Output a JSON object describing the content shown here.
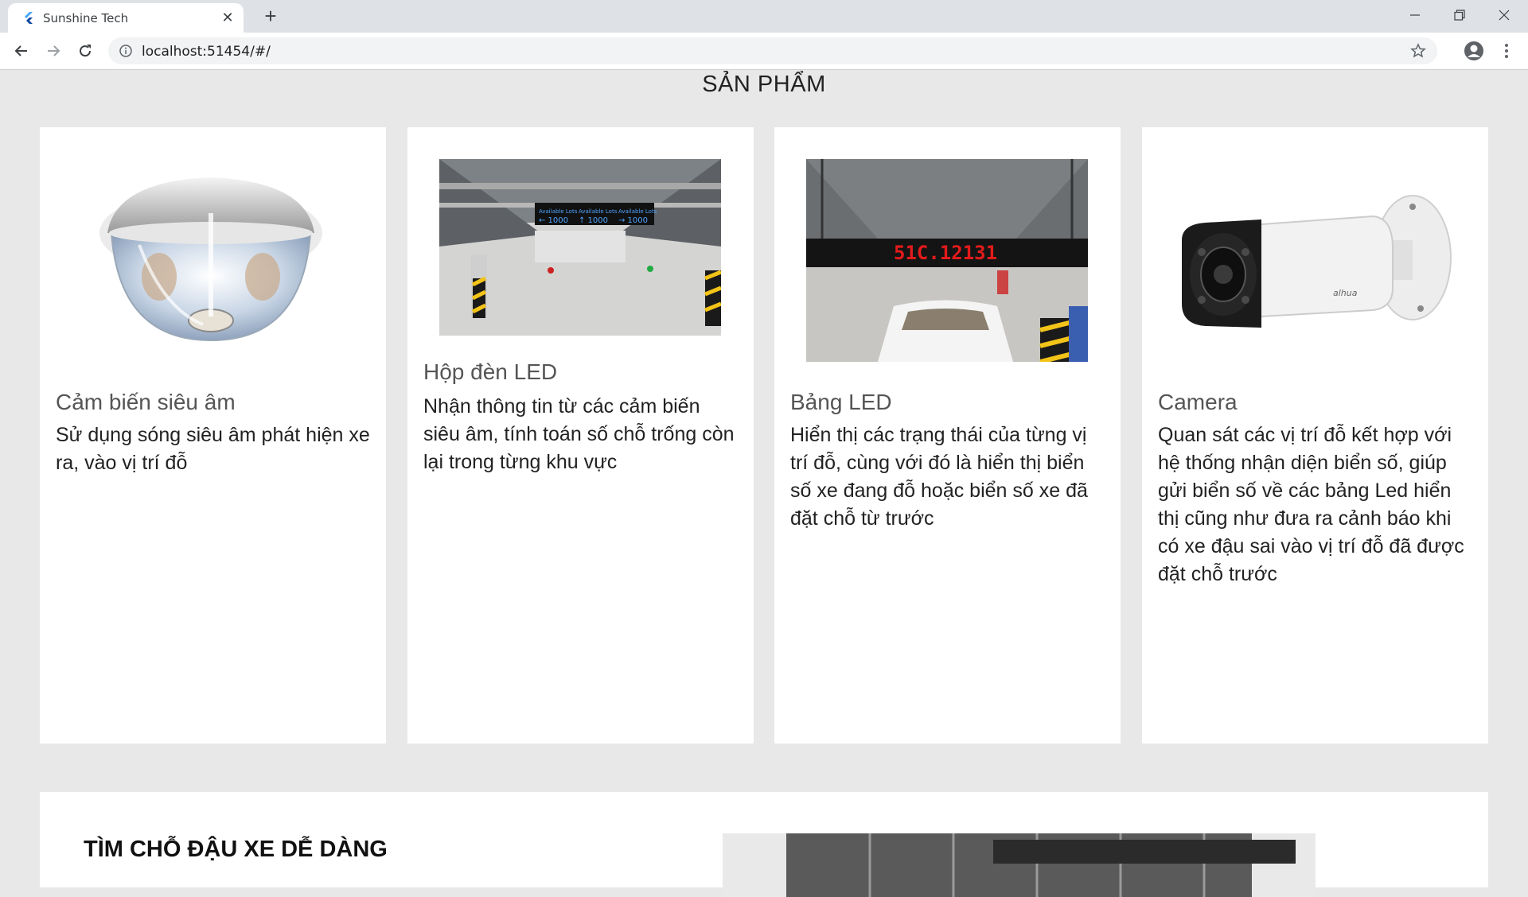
{
  "browser": {
    "tab_title": "Sunshine Tech",
    "url": "localhost:51454/#/"
  },
  "page": {
    "section_title": "SẢN PHẨM",
    "cards": [
      {
        "title": "Cảm biến siêu âm",
        "description": "Sử dụng sóng siêu âm phát hiện xe ra, vào vị trí đỗ",
        "image": "ultrasonic-sensor-photo"
      },
      {
        "title": "Hộp đèn LED",
        "description": "Nhận thông tin từ các cảm biến siêu âm, tính toán số chỗ trống còn lại trong từng khu vực",
        "image": "parking-garage-led-box-photo",
        "image_text": "Available Lots"
      },
      {
        "title": "Bảng LED",
        "description": "Hiển thị các trạng thái của từng vị trí đỗ, cùng với đó là hiển thị biển số xe đang đỗ hoặc biển số xe đã đặt chỗ từ trước",
        "image": "led-board-plate-photo",
        "image_text": "51C.12131"
      },
      {
        "title": "Camera",
        "description": "Quan sát các vị trí đỗ kết hợp với hệ thống nhận diện biển số, giúp gửi biển số về các bảng Led hiển thị cũng như đưa ra cảnh báo khi có xe đậu sai vào vị trí đỗ đã được đặt chỗ trước",
        "image": "bullet-camera-photo",
        "image_text": "alhua"
      }
    ],
    "bottom_title": "TÌM CHỖ ĐẬU XE DỄ DÀNG"
  }
}
